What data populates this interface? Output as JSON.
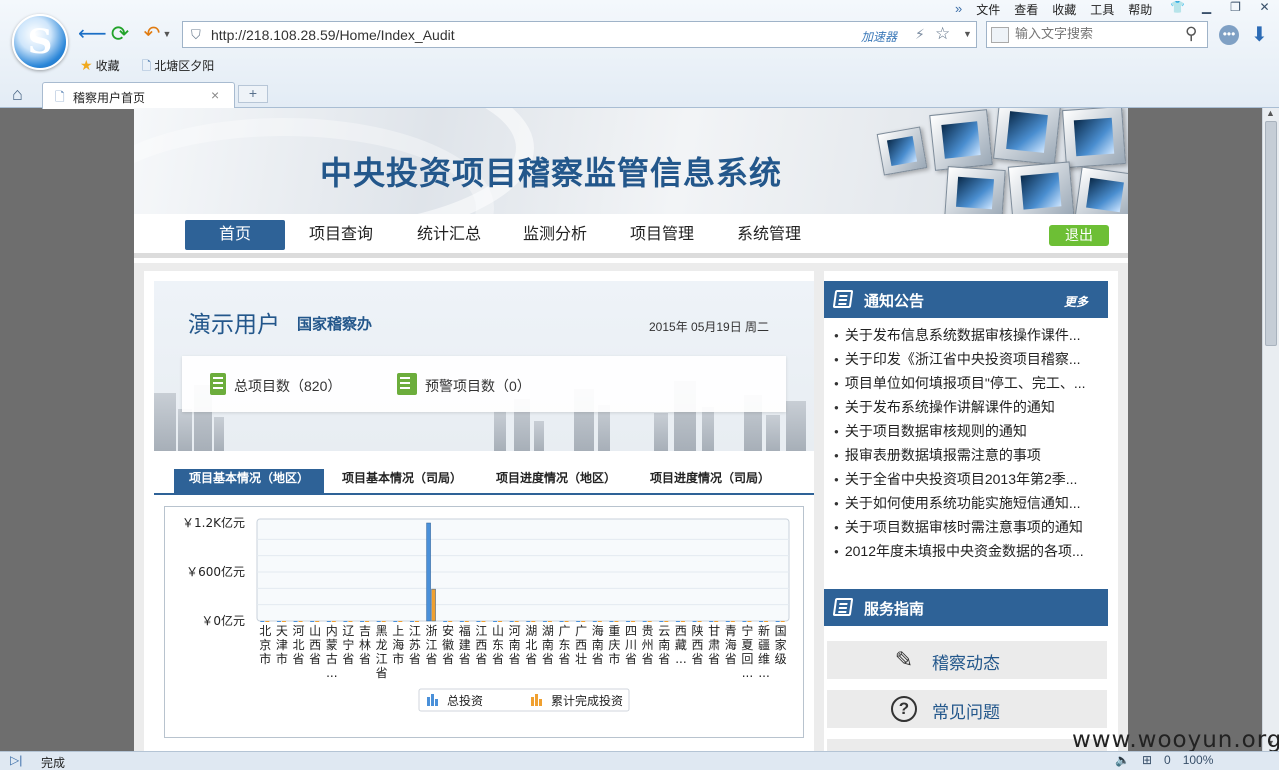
{
  "browser": {
    "menu": [
      "文件",
      "查看",
      "收藏",
      "工具",
      "帮助"
    ],
    "url": "http://218.108.28.59/Home/Index_Audit",
    "accelerator_label": "加速器",
    "search_placeholder": "输入文字搜索",
    "bookmarks": [
      "收藏",
      "北塘区夕阳"
    ],
    "tab_title": "稽察用户首页",
    "status_text": "完成",
    "status_counter": "0",
    "zoom": "100%"
  },
  "site": {
    "title": "中央投资项目稽察监管信息系统",
    "nav": [
      "首页",
      "项目查询",
      "统计汇总",
      "监测分析",
      "项目管理",
      "系统管理"
    ],
    "active_nav": "首页",
    "logout": "退出"
  },
  "user": {
    "name": "演示用户",
    "org": "国家稽察办",
    "date": "2015年 05月19日 周二",
    "total_projects": "总项目数（820）",
    "warning_projects": "预警项目数（0）"
  },
  "chart_tabs": [
    "项目基本情况（地区）",
    "项目基本情况（司局）",
    "项目进度情况（地区）",
    "项目进度情况（司局）"
  ],
  "notice": {
    "title": "通知公告",
    "more": "更多",
    "items": [
      "关于发布信息系统数据审核操作课件...",
      "关于印发《浙江省中央投资项目稽察...",
      "项目单位如何填报项目\"停工、完工、...",
      "关于发布系统操作讲解课件的通知",
      "关于项目数据审核规则的通知",
      "报审表册数据填报需注意的事项",
      "关于全省中央投资项目2013年第2季...",
      "关于如何使用系统功能实施短信通知...",
      "关于项目数据审核时需注意事项的通知",
      "2012年度未填报中央资金数据的各项..."
    ]
  },
  "guide": {
    "title": "服务指南",
    "items": [
      "稽察动态",
      "常见问题"
    ]
  },
  "watermark": "www.wooyun.org",
  "colors": {
    "primary": "#2e6297",
    "logout_green": "#6dbf35",
    "series_total": "#4a90d9",
    "series_completed": "#f0a030"
  },
  "chart_data": {
    "type": "bar",
    "ylabel_ticks": [
      "￥1.2K亿元",
      "￥600亿元",
      "￥0亿元"
    ],
    "ylim": [
      0,
      1200
    ],
    "categories": [
      [
        "北",
        "京",
        "市"
      ],
      [
        "天",
        "津",
        "市"
      ],
      [
        "河",
        "北",
        "省"
      ],
      [
        "山",
        "西",
        "省"
      ],
      [
        "内",
        "蒙",
        "古",
        "..."
      ],
      [
        "辽",
        "宁",
        "省"
      ],
      [
        "吉",
        "林",
        "省"
      ],
      [
        "黑",
        "龙",
        "江",
        "省"
      ],
      [
        "上",
        "海",
        "市"
      ],
      [
        "江",
        "苏",
        "省"
      ],
      [
        "浙",
        "江",
        "省"
      ],
      [
        "安",
        "徽",
        "省"
      ],
      [
        "福",
        "建",
        "省"
      ],
      [
        "江",
        "西",
        "省"
      ],
      [
        "山",
        "东",
        "省"
      ],
      [
        "河",
        "南",
        "省"
      ],
      [
        "湖",
        "北",
        "省"
      ],
      [
        "湖",
        "南",
        "省"
      ],
      [
        "广",
        "东",
        "省"
      ],
      [
        "广",
        "西",
        "壮"
      ],
      [
        "海",
        "南",
        "省"
      ],
      [
        "重",
        "庆",
        "市"
      ],
      [
        "四",
        "川",
        "省"
      ],
      [
        "贵",
        "州",
        "省"
      ],
      [
        "云",
        "南",
        "省"
      ],
      [
        "西",
        "藏",
        "..."
      ],
      [
        "陕",
        "西",
        "省"
      ],
      [
        "甘",
        "肃",
        "省"
      ],
      [
        "青",
        "海",
        "省"
      ],
      [
        "宁",
        "夏",
        "回",
        "..."
      ],
      [
        "新",
        "疆",
        "维",
        "..."
      ],
      [
        "国",
        "家",
        "级"
      ]
    ],
    "series": [
      {
        "name": "总投资",
        "values": [
          0,
          0,
          0,
          0,
          0,
          0,
          0,
          0,
          0,
          0,
          1200,
          0,
          0,
          0,
          0,
          0,
          0,
          0,
          0,
          0,
          0,
          0,
          0,
          0,
          0,
          0,
          0,
          0,
          0,
          0,
          0,
          0
        ]
      },
      {
        "name": "累计完成投资",
        "values": [
          0,
          0,
          0,
          0,
          0,
          0,
          0,
          0,
          0,
          0,
          390,
          0,
          0,
          0,
          0,
          0,
          0,
          0,
          0,
          0,
          0,
          0,
          0,
          0,
          0,
          0,
          0,
          0,
          0,
          0,
          0,
          0
        ]
      }
    ]
  }
}
